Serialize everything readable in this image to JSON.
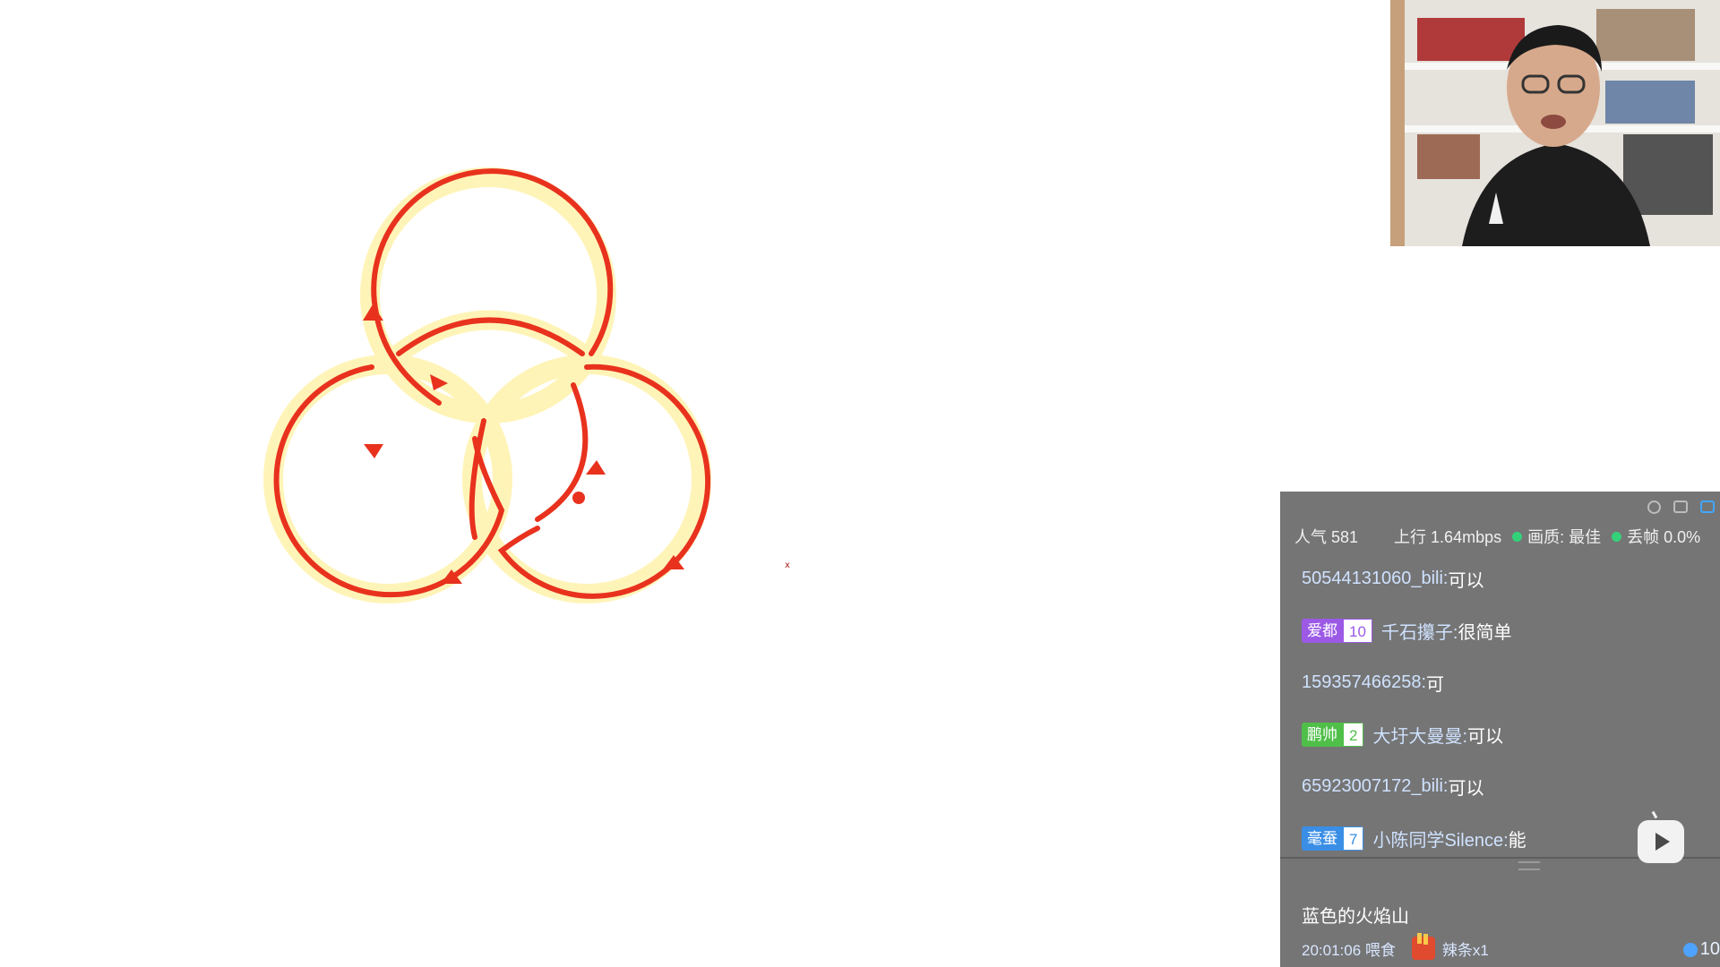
{
  "chat_panel": {
    "stats": {
      "popularity": "人气 581",
      "upload": "上行 1.64mbps",
      "quality": "画质: 最佳",
      "frame_drop": "丢帧 0.0%"
    },
    "messages": [
      {
        "user": "50544131060_bili:",
        "text": " 可以"
      },
      {
        "badge": {
          "name": "爱都",
          "level": "10",
          "color": "purple"
        },
        "user": "千石攥子:",
        "text": " 很简单"
      },
      {
        "user": "159357466258:",
        "text": " 可"
      },
      {
        "badge": {
          "name": "鹏帅",
          "level": "2",
          "color": "green"
        },
        "user": "大圩大曼曼:",
        "text": " 可以"
      },
      {
        "user": "65923007172_bili:",
        "text": " 可以"
      },
      {
        "badge": {
          "name": "毫蚕",
          "level": "7",
          "color": "blue"
        },
        "user": "小陈同学Silence:",
        "text": " 能"
      }
    ],
    "gift": {
      "user": "蓝色的火焰山",
      "time": "20:01:06 喂食",
      "item": "辣条x1",
      "count": "10"
    }
  },
  "icons": [
    "settings-icon",
    "export-icon",
    "window-icon",
    "play-logo-icon",
    "coin-icon",
    "gift-icon"
  ],
  "colors": {
    "ring_stroke": "#e8321e",
    "ring_fill": "#fff3b0",
    "panel_bg": "#757575",
    "status_dot": "#33d17a"
  }
}
